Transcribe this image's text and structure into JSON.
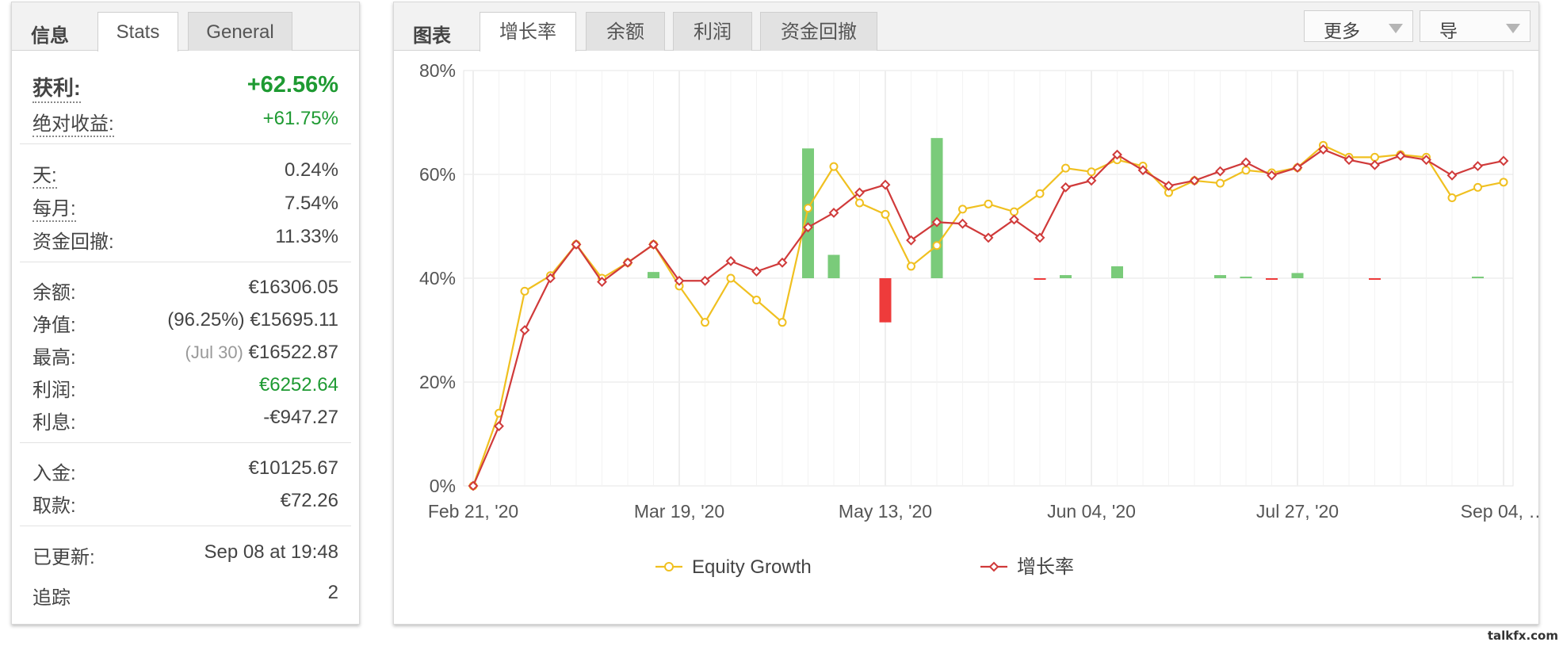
{
  "info": {
    "title": "信息",
    "tabs": [
      "Stats",
      "General"
    ],
    "active_tab": 0,
    "profit": {
      "label": "获利:",
      "value": "+62.56%"
    },
    "absolute_gain": {
      "label": "绝对收益:",
      "value": "+61.75%"
    },
    "daily": {
      "label": "天:",
      "value": "0.24%"
    },
    "monthly": {
      "label": "每月:",
      "value": "7.54%"
    },
    "drawdown": {
      "label": "资金回撤:",
      "value": "11.33%"
    },
    "balance": {
      "label": "余额:",
      "value": "€16306.05"
    },
    "equity": {
      "label": "净值:",
      "note": "(96.25%)",
      "value": "€15695.11"
    },
    "highest": {
      "label": "最高:",
      "note": "(Jul 30)",
      "value": "€16522.87"
    },
    "profit_amount": {
      "label": "利润:",
      "value": "€6252.64"
    },
    "interest": {
      "label": "利息:",
      "value": "-€947.27"
    },
    "deposits": {
      "label": "入金:",
      "value": "€10125.67"
    },
    "withdrawals": {
      "label": "取款:",
      "value": "€72.26"
    },
    "updated": {
      "label": "已更新:",
      "value": "Sep 08 at 19:48"
    },
    "tracking": {
      "label": "追踪",
      "value": "2"
    }
  },
  "chart_panel": {
    "title": "图表",
    "tabs": [
      "增长率",
      "余额",
      "利润",
      "资金回撤"
    ],
    "active_tab": 0,
    "more_label": "更多",
    "export_label": "导"
  },
  "watermark": "talkfx.com",
  "colors": {
    "equity_line": "#f0c020",
    "growth_line": "#d03a3a",
    "bar_positive": "#7acb7a",
    "bar_negative": "#ee3b3b",
    "profit_text": "#1e9a32"
  },
  "chart_data": {
    "type": "line",
    "x_tick_labels": [
      "Feb 21, '20",
      "Mar 19, '20",
      "May 13, '20",
      "Jun 04, '20",
      "Jul 27, '20",
      "Sep 04, …"
    ],
    "y_tick_labels": [
      "0%",
      "20%",
      "40%",
      "60%",
      "80%"
    ],
    "ylim": [
      0,
      80
    ],
    "y_unit": "%",
    "grid": true,
    "legend_position": "bottom",
    "series": [
      {
        "name": "Equity Growth",
        "values": [
          0,
          14,
          37.5,
          40.5,
          46.5,
          40,
          43,
          46.5,
          38.5,
          31.5,
          40,
          35.8,
          31.5,
          53.5,
          61.5,
          54.5,
          52.3,
          42.3,
          46.3,
          53.3,
          54.3,
          52.8,
          56.3,
          61.2,
          60.5,
          62.8,
          61.6,
          56.5,
          58.8,
          58.3,
          60.8,
          60.3,
          61.3,
          65.6,
          63.3,
          63.3,
          63.8,
          63.3,
          55.5,
          57.5,
          58.5
        ]
      },
      {
        "name": "增长率",
        "values": [
          0,
          11.5,
          30,
          40,
          46.5,
          39.3,
          43,
          46.5,
          39.5,
          39.5,
          43.3,
          41.3,
          43,
          49.8,
          52.6,
          56.5,
          58,
          47.3,
          50.8,
          50.5,
          47.8,
          51.3,
          47.8,
          57.5,
          58.8,
          63.8,
          60.8,
          57.8,
          58.8,
          60.6,
          62.3,
          59.8,
          61.3,
          64.8,
          62.8,
          61.8,
          63.6,
          62.8,
          59.8,
          61.6,
          62.6
        ]
      }
    ],
    "bars": [
      {
        "index": 7,
        "value": 1.2
      },
      {
        "index": 13,
        "value": 25
      },
      {
        "index": 14,
        "value": 4.5
      },
      {
        "index": 16,
        "value": -8.5
      },
      {
        "index": 18,
        "value": 27
      },
      {
        "index": 22,
        "value": -0.3
      },
      {
        "index": 23,
        "value": 0.6
      },
      {
        "index": 25,
        "value": 2.3
      },
      {
        "index": 29,
        "value": 0.6
      },
      {
        "index": 30,
        "value": 0.3
      },
      {
        "index": 31,
        "value": -0.3
      },
      {
        "index": 32,
        "value": 1.0
      },
      {
        "index": 35,
        "value": -0.3
      },
      {
        "index": 39,
        "value": 0.3
      }
    ]
  }
}
